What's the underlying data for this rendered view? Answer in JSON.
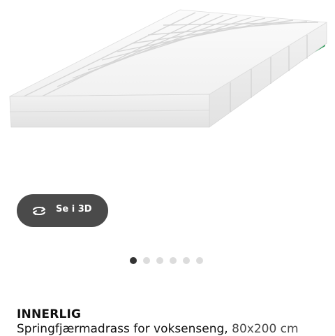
{
  "gallery": {
    "image_alt": "mattress-product-photo",
    "view_3d": {
      "label": "Se i 3D",
      "icon": "rotate-3d-icon"
    },
    "pagination": {
      "total": 6,
      "active_index": 0
    }
  },
  "product": {
    "name": "INNERLIG",
    "type": "Springfjærmadrass for voksenseng,",
    "size": "80x200 cm"
  },
  "colors": {
    "button_bg": "#4a4a4a",
    "dot_active": "#333333",
    "dot_inactive": "#dcdcdc",
    "mattress_green_edge": "#2e9e5b"
  }
}
